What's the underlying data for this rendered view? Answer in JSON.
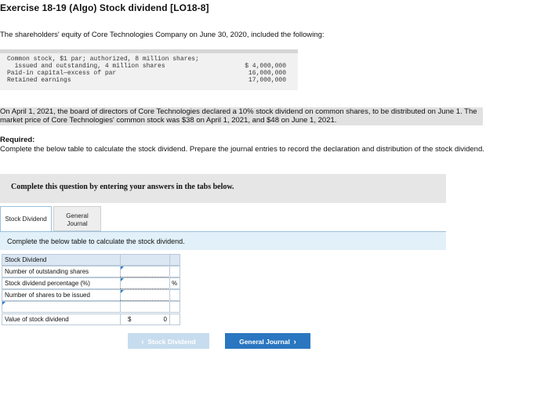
{
  "title": "Exercise 18-19 (Algo) Stock dividend [LO18-8]",
  "intro": "The shareholders' equity of Core Technologies Company on June 30, 2020, included the following:",
  "equity_table": {
    "rows": [
      {
        "label": "Common stock, $1 par; authorized, 8 million shares;",
        "value": ""
      },
      {
        "label": "  issued and outstanding, 4 million shares",
        "value": "$ 4,000,000"
      },
      {
        "label": "Paid-in capital—excess of par",
        "value": "16,000,000"
      },
      {
        "label": "Retained earnings",
        "value": "17,000,000"
      }
    ]
  },
  "paragraph": "On April 1, 2021, the board of directors of Core Technologies declared a 10% stock dividend on common shares, to be distributed on June 1. The market price of Core Technologies' common stock was $38 on April 1, 2021, and $48 on June 1, 2021.",
  "required": {
    "title": "Required:",
    "text": "Complete the below table to calculate the stock dividend. Prepare the journal entries to record the declaration and distribution of the stock dividend."
  },
  "instruction": "Complete this question by entering your answers in the tabs below.",
  "tabs": [
    {
      "label": "Stock Dividend"
    },
    {
      "label": "General Journal"
    }
  ],
  "panel_text": "Complete the below table to calculate the stock dividend.",
  "calc_table": {
    "header": "Stock Dividend",
    "rows": [
      {
        "label": "Number of outstanding shares",
        "value": "",
        "suffix": ""
      },
      {
        "label": "Stock dividend percentage (%)",
        "value": "",
        "suffix": "%"
      },
      {
        "label": "Number of shares to be issued",
        "value": "",
        "suffix": ""
      }
    ],
    "total": {
      "label": "Value of stock dividend",
      "currency": "$",
      "value": "0"
    }
  },
  "nav": {
    "prev": "Stock Dividend",
    "next": "General Journal"
  },
  "colors": {
    "accent": "#2a76c0",
    "panel_bg": "#e1f0f9",
    "header_bg": "#dbe7f3"
  }
}
